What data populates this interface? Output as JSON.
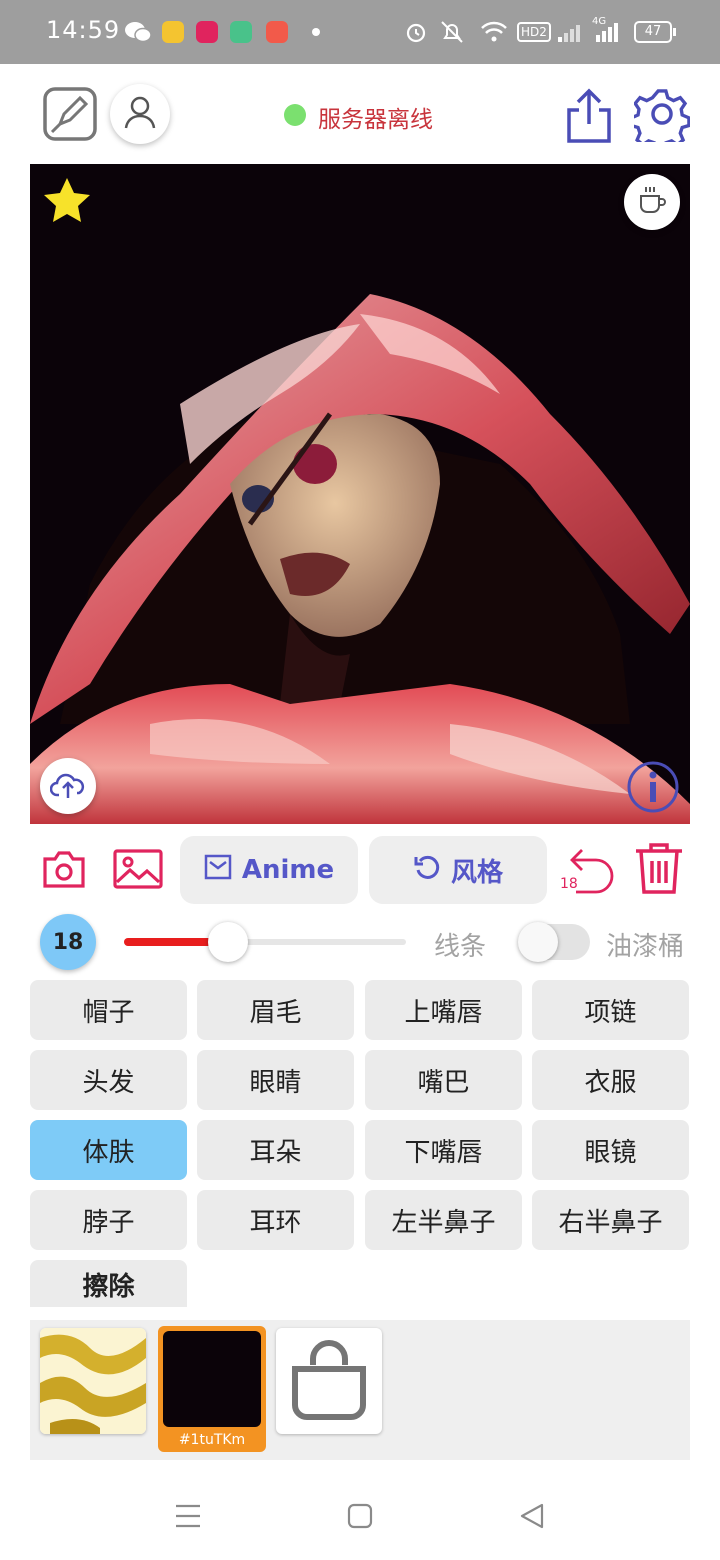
{
  "status_bar": {
    "time": "14:59",
    "network_label": "4G",
    "hd_label": "HD2",
    "battery": "47"
  },
  "header": {
    "server_status": "服务器离线",
    "server_status_color": "#7be06f"
  },
  "canvas": {
    "description_icon": "info-icon"
  },
  "toolbar": {
    "anime_label": "Anime",
    "style_label": "风格",
    "undo_count": "18"
  },
  "brush": {
    "size": "18",
    "slider_fraction": 0.37,
    "line_label": "线条",
    "bucket_label": "油漆桶",
    "bucket_enabled": false
  },
  "parts": [
    {
      "label": "帽子",
      "selected": false
    },
    {
      "label": "眉毛",
      "selected": false
    },
    {
      "label": "上嘴唇",
      "selected": false
    },
    {
      "label": "项链",
      "selected": false
    },
    {
      "label": "头发",
      "selected": false
    },
    {
      "label": "眼睛",
      "selected": false
    },
    {
      "label": "嘴巴",
      "selected": false
    },
    {
      "label": "衣服",
      "selected": false
    },
    {
      "label": "体肤",
      "selected": true
    },
    {
      "label": "耳朵",
      "selected": false
    },
    {
      "label": "下嘴唇",
      "selected": false
    },
    {
      "label": "眼镜",
      "selected": false
    },
    {
      "label": "脖子",
      "selected": false
    },
    {
      "label": "耳环",
      "selected": false
    },
    {
      "label": "左半鼻子",
      "selected": false
    },
    {
      "label": "右半鼻子",
      "selected": false
    },
    {
      "label": "擦除",
      "selected": false
    }
  ],
  "palette": {
    "selected_color_label": "#1tuTKm",
    "selected_color": "#0b0309",
    "selected_border": "#f39322"
  },
  "colors": {
    "accent_red": "#e0245e",
    "accent_blue": "#4a4db6",
    "selected_part": "#7ecbf7"
  }
}
